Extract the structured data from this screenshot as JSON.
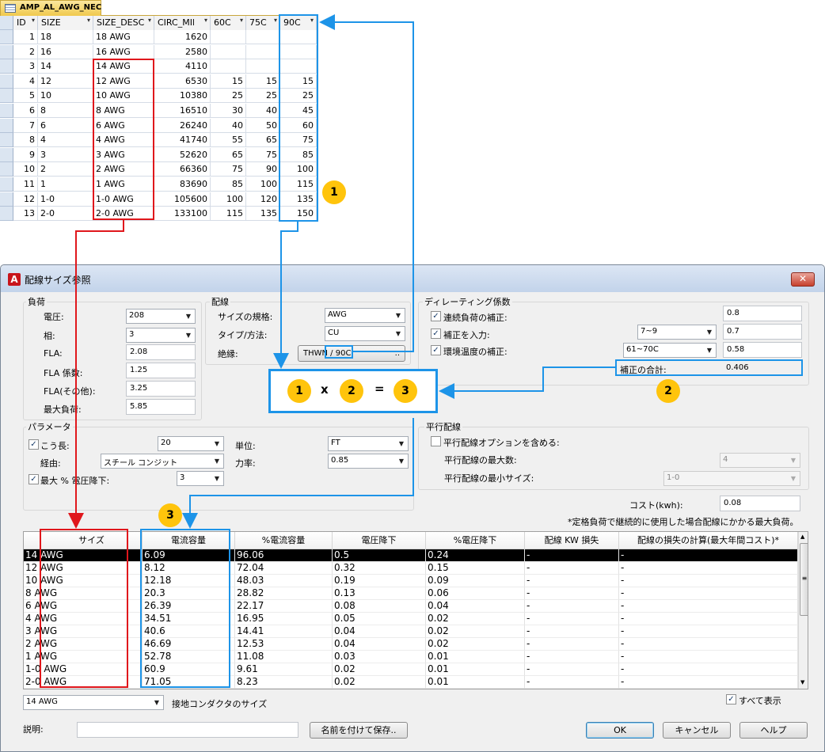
{
  "access_table": {
    "tab_title": "AMP_AL_AWG_NEC",
    "columns": [
      "ID",
      "SIZE",
      "SIZE_DESC",
      "CIRC_MIl",
      "60C",
      "75C",
      "90C"
    ],
    "rows": [
      [
        "1",
        "18",
        "18 AWG",
        "1620",
        "",
        "",
        ""
      ],
      [
        "2",
        "16",
        "16 AWG",
        "2580",
        "",
        "",
        ""
      ],
      [
        "3",
        "14",
        "14 AWG",
        "4110",
        "",
        "",
        ""
      ],
      [
        "4",
        "12",
        "12 AWG",
        "6530",
        "15",
        "15",
        "15"
      ],
      [
        "5",
        "10",
        "10 AWG",
        "10380",
        "25",
        "25",
        "25"
      ],
      [
        "6",
        "8",
        "8 AWG",
        "16510",
        "30",
        "40",
        "45"
      ],
      [
        "7",
        "6",
        "6 AWG",
        "26240",
        "40",
        "50",
        "60"
      ],
      [
        "8",
        "4",
        "4 AWG",
        "41740",
        "55",
        "65",
        "75"
      ],
      [
        "9",
        "3",
        "3 AWG",
        "52620",
        "65",
        "75",
        "85"
      ],
      [
        "10",
        "2",
        "2 AWG",
        "66360",
        "75",
        "90",
        "100"
      ],
      [
        "11",
        "1",
        "1 AWG",
        "83690",
        "85",
        "100",
        "115"
      ],
      [
        "12",
        "1-0",
        "1-0 AWG",
        "105600",
        "100",
        "120",
        "135"
      ],
      [
        "13",
        "2-0",
        "2-0 AWG",
        "133100",
        "115",
        "135",
        "150"
      ]
    ]
  },
  "dialog": {
    "title": "配線サイズ参照",
    "load": {
      "group_label": "負荷",
      "voltage_label": "電圧:",
      "voltage_value": "208",
      "phase_label": "相:",
      "phase_value": "3",
      "fla_label": "FLA:",
      "fla_value": "2.08",
      "fla_factor_label": "FLA 係数:",
      "fla_factor_value": "1.25",
      "fla_other_label": "FLA(その他):",
      "fla_other_value": "3.25",
      "max_load_label": "最大負荷:",
      "max_load_value": "5.85"
    },
    "wiring": {
      "group_label": "配線",
      "standard_label": "サイズの規格:",
      "standard_value": "AWG",
      "type_label": "タイプ/方法:",
      "type_value": "CU",
      "insulation_label": "絶縁:",
      "insulation_value": "THWN / 90C"
    },
    "derating": {
      "group_label": "ディレーティング係数",
      "continuous_label": "連続負荷の補正:",
      "continuous_value": "0.8",
      "input_label": "補正を入力:",
      "input_select": "7~9",
      "input_value": "0.7",
      "ambient_label": "環境温度の補正:",
      "ambient_select": "61~70C",
      "ambient_value": "0.58",
      "total_label": "補正の合計:",
      "total_value": "0.406"
    },
    "parameters": {
      "group_label": "パラメータ",
      "length_label": "こう長:",
      "length_value": "20",
      "unit_label": "単位:",
      "unit_value": "FT",
      "route_label": "経由:",
      "route_value": "スチール コンジット",
      "pf_label": "力率:",
      "pf_value": "0.85",
      "vdrop_label": "最大 % 電圧降下:",
      "vdrop_value": "3"
    },
    "parallel": {
      "group_label": "平行配線",
      "include_label": "平行配線オプションを含める:",
      "max_count_label": "平行配線の最大数:",
      "max_count_value": "4",
      "min_size_label": "平行配線の最小サイズ:",
      "min_size_value": "1-0"
    },
    "cost_label": "コスト(kwh):",
    "cost_value": "0.08",
    "note": "*定格負荷で継続的に使用した場合配線にかかる最大負荷。",
    "results": {
      "columns": [
        "サイズ",
        "電流容量",
        "%電流容量",
        "電圧降下",
        "%電圧降下",
        "配線 KW 損失",
        "配線の損失の計算(最大年間コスト)*"
      ],
      "rows": [
        [
          "14 AWG",
          "6.09",
          "96.06",
          "0.5",
          "0.24",
          "-",
          "-"
        ],
        [
          "12 AWG",
          "8.12",
          "72.04",
          "0.32",
          "0.15",
          "-",
          "-"
        ],
        [
          "10 AWG",
          "12.18",
          "48.03",
          "0.19",
          "0.09",
          "-",
          "-"
        ],
        [
          "8 AWG",
          "20.3",
          "28.82",
          "0.13",
          "0.06",
          "-",
          "-"
        ],
        [
          "6 AWG",
          "26.39",
          "22.17",
          "0.08",
          "0.04",
          "-",
          "-"
        ],
        [
          "4 AWG",
          "34.51",
          "16.95",
          "0.05",
          "0.02",
          "-",
          "-"
        ],
        [
          "3 AWG",
          "40.6",
          "14.41",
          "0.04",
          "0.02",
          "-",
          "-"
        ],
        [
          "2 AWG",
          "46.69",
          "12.53",
          "0.04",
          "0.02",
          "-",
          "-"
        ],
        [
          "1 AWG",
          "52.78",
          "11.08",
          "0.03",
          "0.01",
          "-",
          "-"
        ],
        [
          "1-0 AWG",
          "60.9",
          "9.61",
          "0.02",
          "0.01",
          "-",
          "-"
        ],
        [
          "2-0 AWG",
          "71.05",
          "8.23",
          "0.02",
          "0.01",
          "-",
          "-"
        ]
      ]
    },
    "ground_size_value": "14 AWG",
    "ground_size_label": "接地コンダクタのサイズ",
    "show_all_label": "すべて表示",
    "description_label": "説明:",
    "save_as_label": "名前を付けて保存..",
    "ok_label": "OK",
    "cancel_label": "キャンセル",
    "help_label": "ヘルプ"
  },
  "annotations": {
    "badge1": "1",
    "badge2": "2",
    "badge3": "3",
    "formula_a": "1",
    "formula_op1": "x",
    "formula_b": "2",
    "formula_op2": "=",
    "formula_c": "3",
    "red_color": "#e0171c",
    "blue_color": "#1d94e8",
    "badge_color": "#ffc40c"
  }
}
